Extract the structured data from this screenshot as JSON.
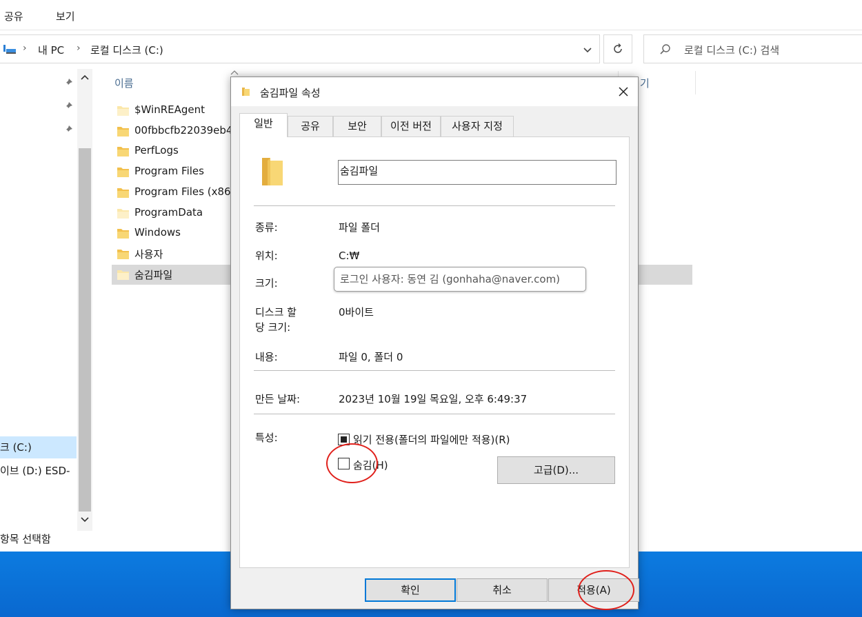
{
  "ribbon": {
    "tabs": [
      "공유",
      "보기"
    ]
  },
  "address": {
    "crumbs": [
      "내 PC",
      "로컬 디스크 (C:)"
    ]
  },
  "search": {
    "placeholder": "로컬 디스크 (C:) 검색"
  },
  "nav": {
    "drive_c": "크 (C:)",
    "drive_d": "이브 (D:) ESD-"
  },
  "file_list": {
    "column_name": "이름",
    "column_frag": "기",
    "items": [
      "$WinREAgent",
      "00fbbcfb22039eb4",
      "PerfLogs",
      "Program Files",
      "Program Files (x86",
      "ProgramData",
      "Windows",
      "사용자",
      "숨김파일"
    ],
    "selected_index": 8
  },
  "status": {
    "text": "항목 선택함"
  },
  "dialog": {
    "title": "숨김파일 속성",
    "tabs": [
      "일반",
      "공유",
      "보안",
      "이전 버전",
      "사용자 지정"
    ],
    "active_tab": "일반",
    "folder_name": "숨김파일",
    "properties": {
      "type_label": "종류:",
      "type_value": "파일 폴더",
      "location_label": "위치:",
      "location_value": "C:₩",
      "size_label": "크기:",
      "disk_size_label_1": "디스크 할",
      "disk_size_label_2": "당 크기:",
      "disk_size_value": "0바이트",
      "contents_label": "내용:",
      "contents_value": "파일 0, 폴더 0",
      "created_label": "만든 날짜:",
      "created_value": "2023년 10월 19일 목요일, 오후 6:49:37"
    },
    "tooltip": "로그인 사용자: 동연 김 (gonhaha@naver.com)",
    "attributes": {
      "label": "특성:",
      "readonly_label": "읽기 전용(폴더의 파일에만 적용)(R)",
      "readonly_state": "indeterminate",
      "hidden_label": "숨김(H)",
      "hidden_checked": false,
      "advanced_button": "고급(D)..."
    },
    "buttons": {
      "ok": "확인",
      "cancel": "취소",
      "apply": "적용(A)"
    }
  },
  "colors": {
    "accent": "#0078d7",
    "highlight": "#e0201b",
    "folder": "#f8d775",
    "desktop": "#0a6fd8"
  }
}
